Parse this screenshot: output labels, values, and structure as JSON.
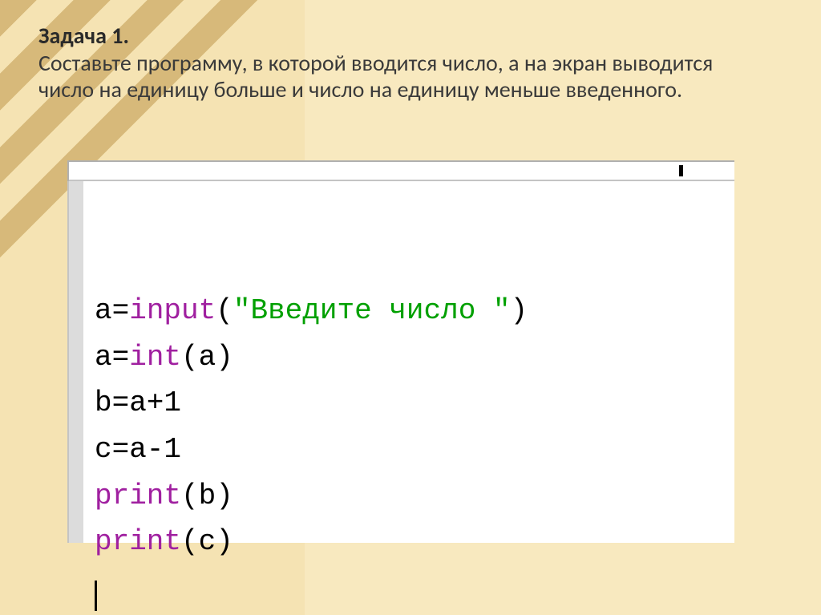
{
  "heading": {
    "title": "Задача 1.",
    "body": "Составьте программу, в которой вводится число, а на экран выводится число на единицу больше и число на единицу меньше введенного."
  },
  "code": {
    "line1": {
      "a": "a",
      "eq": "=",
      "fn": "input",
      "lp": "(",
      "str": "\"Введите число \"",
      "rp": ")"
    },
    "line2": {
      "a": "a",
      "eq": "=",
      "fn": "int",
      "lp": "(",
      "arg": "a",
      "rp": ")"
    },
    "line3": {
      "text": "b=a+1"
    },
    "line4": {
      "text": "c=a-1"
    },
    "line5": {
      "fn": "print",
      "lp": "(",
      "arg": "b",
      "rp": ")"
    },
    "line6": {
      "fn": "print",
      "lp": "(",
      "arg": "c",
      "rp": ")"
    }
  }
}
